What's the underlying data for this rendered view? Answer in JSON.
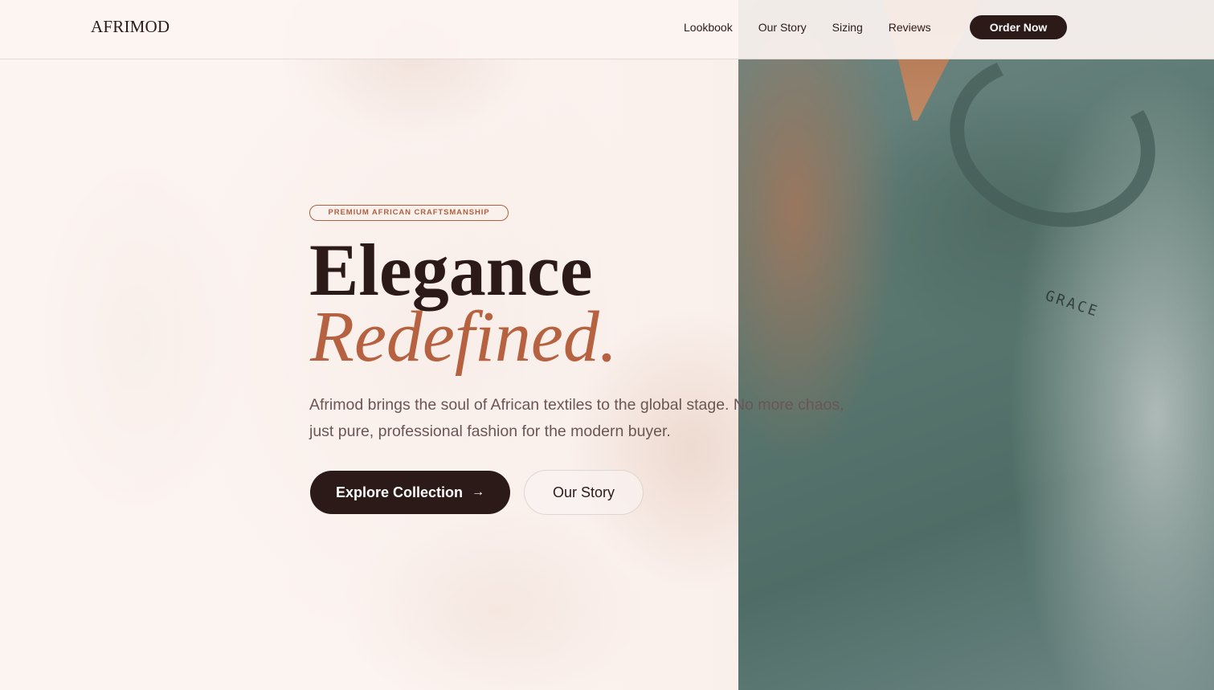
{
  "nav": {
    "logo": "AFRIMOD",
    "links": [
      "Lookbook",
      "Our Story",
      "Sizing",
      "Reviews"
    ],
    "cta": "Order Now"
  },
  "hero": {
    "badge": "PREMIUM AFRICAN CRAFTSMANSHIP",
    "title_line1": "Elegance",
    "title_line2": "Redefined.",
    "description": "Afrimod brings the soul of African textiles to the global stage. No more chaos, just pure, professional fashion for the modern buyer.",
    "primary_button": "Explore Collection",
    "primary_button_icon": "arrow-right-icon",
    "secondary_button": "Our Story"
  },
  "images": {
    "right_photo_label": "GRACE"
  },
  "colors": {
    "dark": "#2c1a18",
    "accent": "#b6613f",
    "background": "#fcf3f1"
  }
}
